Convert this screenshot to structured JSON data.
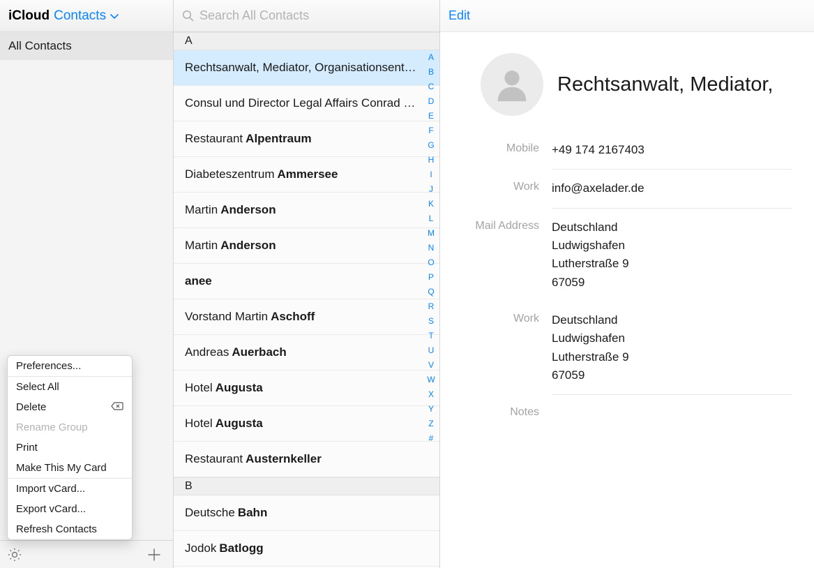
{
  "header": {
    "title_a": "iCloud",
    "title_b": "Contacts"
  },
  "sidebar": {
    "item_all": "All Contacts"
  },
  "popup": {
    "preferences": "Preferences...",
    "select_all": "Select All",
    "delete": "Delete",
    "rename_group": "Rename Group",
    "print": "Print",
    "make_my_card": "Make This My Card",
    "import_vcard": "Import vCard...",
    "export_vcard": "Export vCard...",
    "refresh": "Refresh Contacts"
  },
  "search": {
    "placeholder": "Search All Contacts"
  },
  "sections": {
    "A": "A",
    "B": "B"
  },
  "contacts": {
    "a": [
      {
        "text": "Rechtsanwalt, Mediator, Organisationsent…",
        "selected": true,
        "bold": false
      },
      {
        "text": "Consul und Director Legal Affairs Conrad …",
        "bold": false
      },
      {
        "first": "Restaurant",
        "last": "Alpentraum"
      },
      {
        "first": "Diabeteszentrum",
        "last": "Ammersee"
      },
      {
        "first": "Martin",
        "last": "Anderson"
      },
      {
        "first": "Martin",
        "last": "Anderson"
      },
      {
        "text": "anee",
        "bold": true
      },
      {
        "first": "Vorstand Martin",
        "last": "Aschoff"
      },
      {
        "first": "Andreas",
        "last": "Auerbach"
      },
      {
        "first": "Hotel",
        "last": "Augusta"
      },
      {
        "first": "Hotel",
        "last": "Augusta"
      },
      {
        "first": "Restaurant",
        "last": "Austernkeller"
      }
    ],
    "b": [
      {
        "first": "Deutsche",
        "last": "Bahn"
      },
      {
        "first": "Jodok",
        "last": "Batlogg"
      }
    ]
  },
  "alpha": [
    "A",
    "B",
    "C",
    "D",
    "E",
    "F",
    "G",
    "H",
    "I",
    "J",
    "K",
    "L",
    "M",
    "N",
    "O",
    "P",
    "Q",
    "R",
    "S",
    "T",
    "U",
    "V",
    "W",
    "X",
    "Y",
    "Z",
    "#"
  ],
  "detail": {
    "edit": "Edit",
    "name": "Rechtsanwalt, Mediator,",
    "fields": [
      {
        "label": "Mobile",
        "value": "+49 174 2167403",
        "sep": true
      },
      {
        "label": "Work",
        "value": "info@axelader.de",
        "sep": true
      },
      {
        "label": "Mail Address",
        "value": "Deutschland\nLudwigshafen\nLutherstraße 9\n67059",
        "sep": false
      },
      {
        "label": "Work",
        "value": "Deutschland\nLudwigshafen\nLutherstraße 9\n67059",
        "sep": true
      },
      {
        "label": "Notes",
        "value": "",
        "sep": false
      }
    ]
  }
}
